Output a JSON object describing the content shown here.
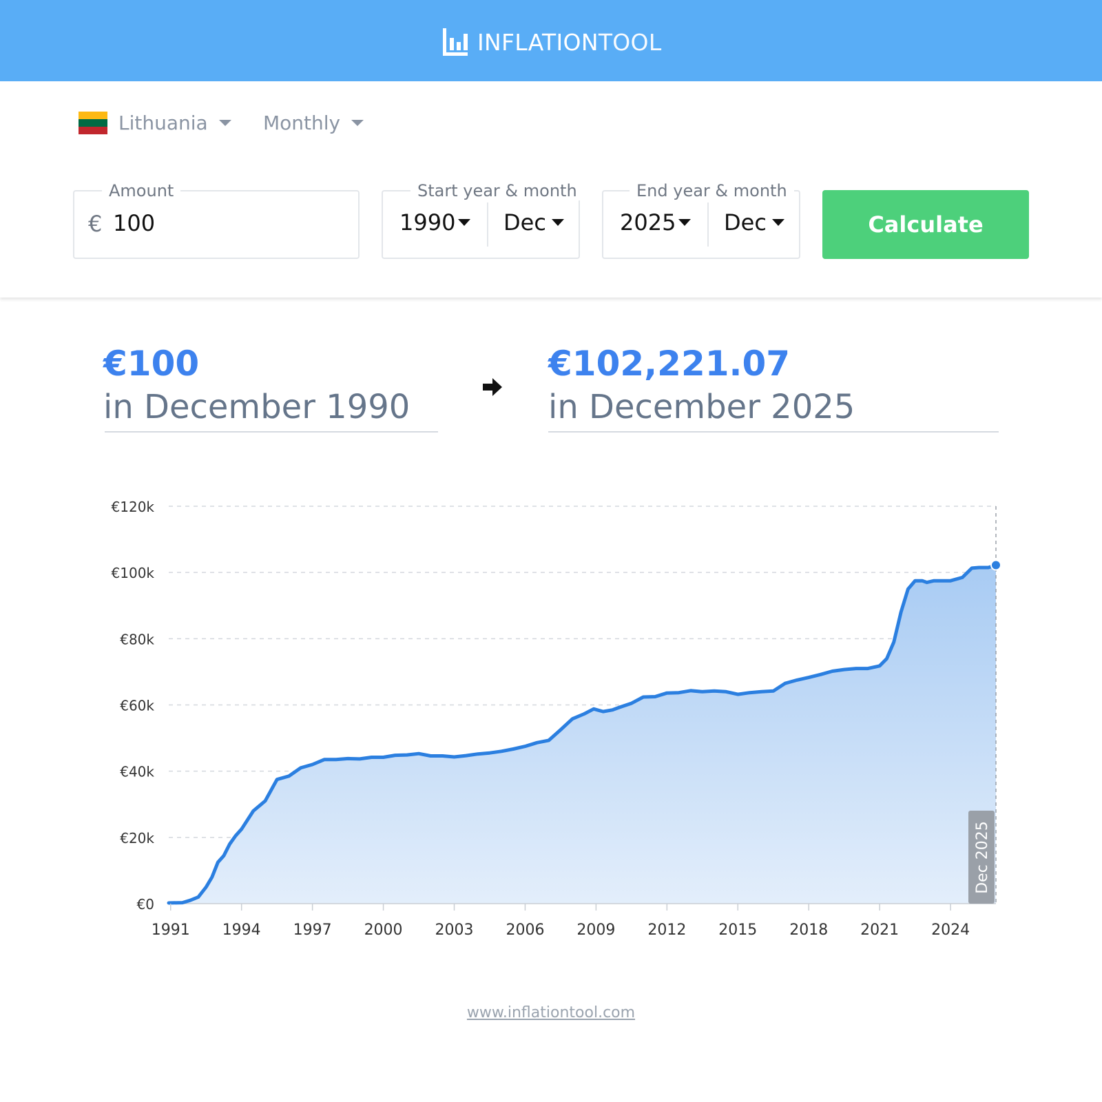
{
  "header": {
    "logo_bold": "INFLATION",
    "logo_light": "TOOL",
    "logo_icon": "bar-chart-icon"
  },
  "filters": {
    "country": "Lithuania",
    "flag_colors": [
      "#fdb913",
      "#006a44",
      "#c1272d"
    ],
    "frequency": "Monthly"
  },
  "form": {
    "amount_label": "Amount",
    "currency_symbol": "€",
    "amount_value": "100",
    "start_label": "Start year & month",
    "start_year": "1990",
    "start_month": "Dec",
    "end_label": "End year & month",
    "end_year": "2025",
    "end_month": "Dec",
    "calculate_label": "Calculate"
  },
  "result": {
    "from_amount": "€100",
    "from_date": "in December 1990",
    "to_amount": "€102,221.07",
    "to_date": "in December 2025"
  },
  "colors": {
    "header": "#59adf6",
    "accent": "#3d82ee",
    "line": "#2b7fe0",
    "button": "#4dd07b"
  },
  "chart_data": {
    "type": "area",
    "title": "",
    "xlabel": "",
    "ylabel": "",
    "x": [
      1990.92,
      1991.5,
      1991.83,
      1992.17,
      1992.5,
      1992.75,
      1993.0,
      1993.25,
      1993.5,
      1993.75,
      1994.0,
      1994.5,
      1995.0,
      1995.5,
      1996.0,
      1996.5,
      1997.0,
      1997.5,
      1998.0,
      1998.5,
      1999.0,
      1999.5,
      2000.0,
      2000.5,
      2001.0,
      2001.5,
      2002.0,
      2002.5,
      2003.0,
      2003.5,
      2004.0,
      2004.5,
      2005.0,
      2005.5,
      2006.0,
      2006.5,
      2007.0,
      2007.5,
      2008.0,
      2008.5,
      2008.9,
      2009.3,
      2009.7,
      2010.0,
      2010.5,
      2011.0,
      2011.5,
      2012.0,
      2012.5,
      2013.0,
      2013.5,
      2014.0,
      2014.5,
      2015.0,
      2015.5,
      2016.0,
      2016.5,
      2017.0,
      2017.5,
      2018.0,
      2018.5,
      2019.0,
      2019.5,
      2020.0,
      2020.5,
      2021.0,
      2021.3,
      2021.6,
      2021.9,
      2022.2,
      2022.5,
      2022.8,
      2023.0,
      2023.3,
      2023.6,
      2024.0,
      2024.5,
      2024.9,
      2025.2,
      2025.6,
      2025.92
    ],
    "y": [
      200,
      300,
      1000,
      2000,
      5000,
      8000,
      12500,
      14500,
      18000,
      20500,
      22500,
      28000,
      31000,
      37500,
      38500,
      41000,
      42000,
      43500,
      43500,
      43800,
      43700,
      44200,
      44200,
      44800,
      44900,
      45300,
      44600,
      44600,
      44300,
      44700,
      45200,
      45500,
      46000,
      46700,
      47500,
      48600,
      49300,
      52500,
      55800,
      57300,
      58800,
      58000,
      58500,
      59300,
      60500,
      62400,
      62500,
      63600,
      63700,
      64300,
      64000,
      64200,
      64000,
      63200,
      63700,
      64000,
      64200,
      66500,
      67500,
      68300,
      69200,
      70200,
      70700,
      71000,
      71000,
      71800,
      74000,
      79000,
      88000,
      95000,
      97500,
      97500,
      97000,
      97500,
      97500,
      97500,
      98500,
      101300,
      101500,
      101500,
      102221
    ],
    "x_ticks": [
      "1991",
      "1994",
      "1997",
      "2000",
      "2003",
      "2006",
      "2009",
      "2012",
      "2015",
      "2018",
      "2021",
      "2024"
    ],
    "y_ticks": [
      "€0",
      "€20k",
      "€40k",
      "€60k",
      "€80k",
      "€100k",
      "€120k"
    ],
    "xlim": [
      1990.92,
      2025.92
    ],
    "ylim": [
      0,
      120000
    ],
    "grid": true,
    "legend": "none",
    "marker_label": "Dec 2025"
  },
  "footer": {
    "link_text": "www.inflationtool.com"
  }
}
